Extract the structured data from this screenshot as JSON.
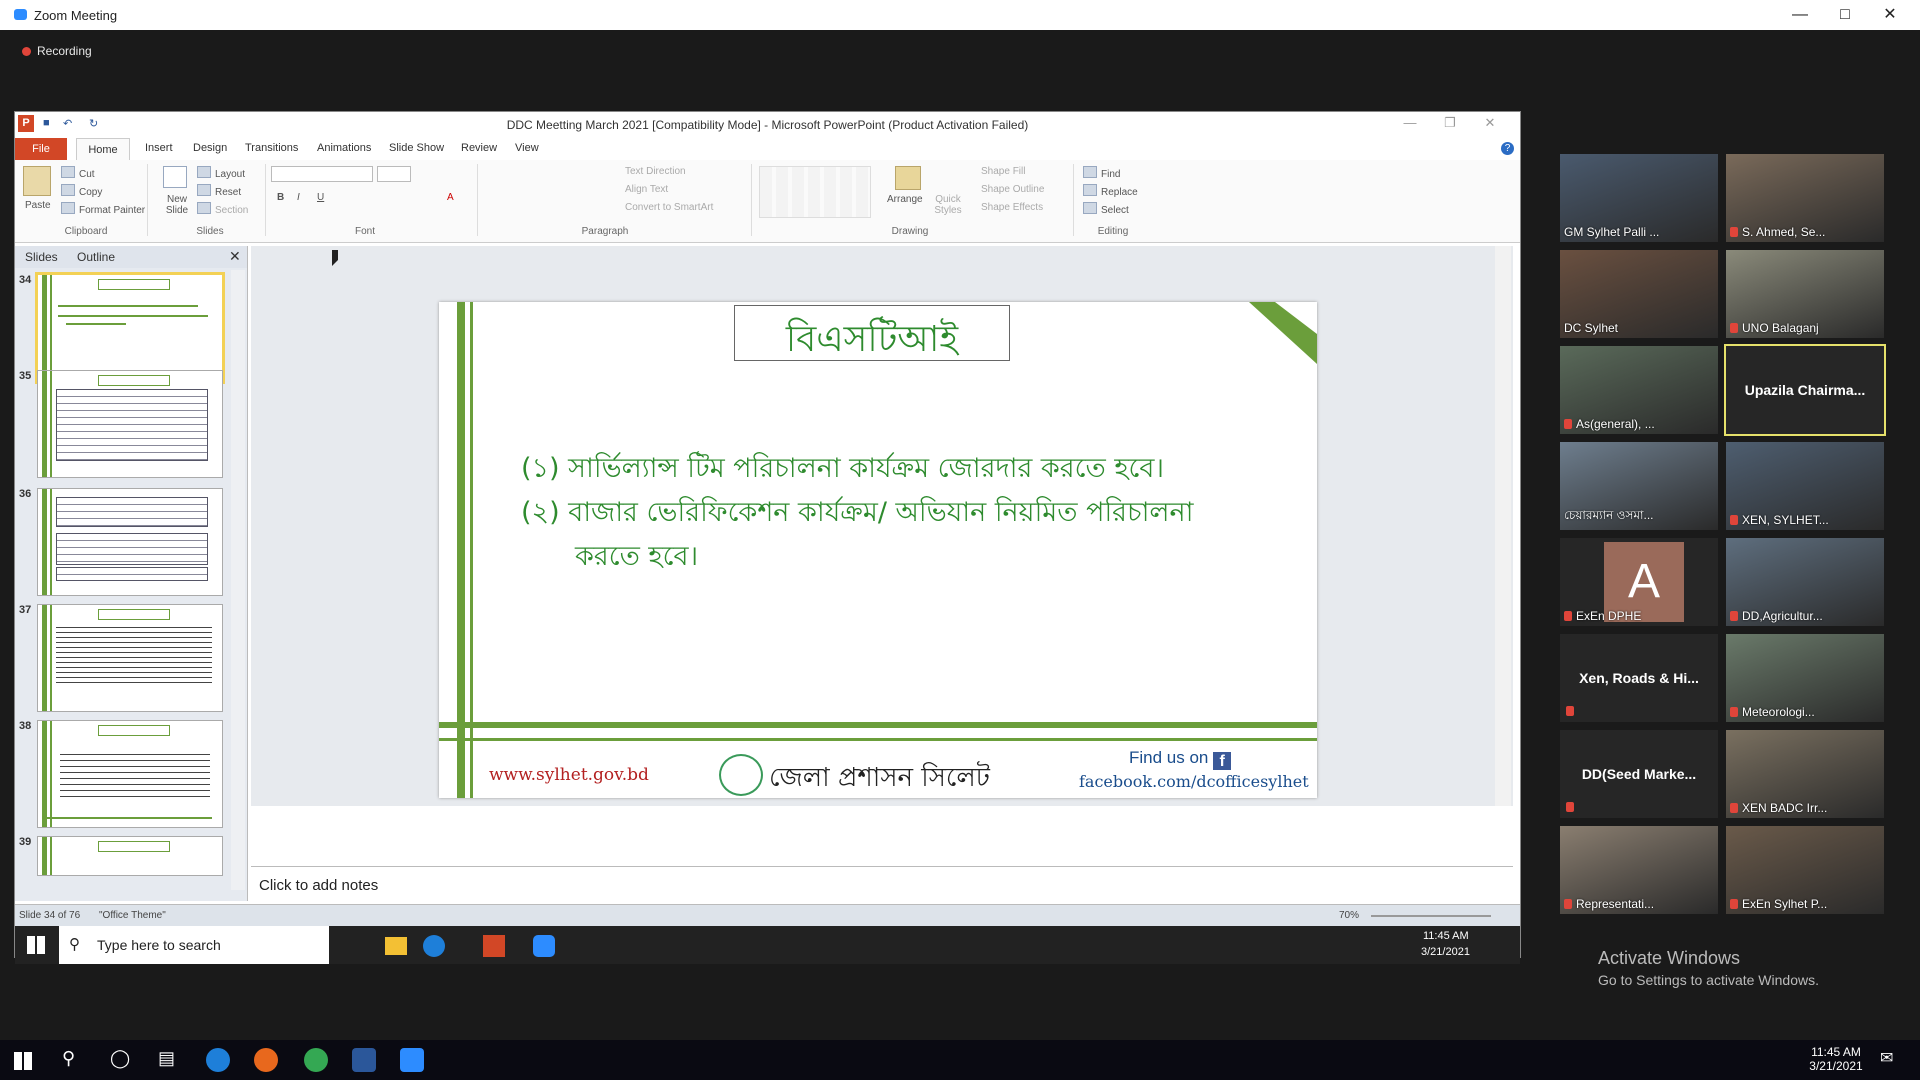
{
  "zoom": {
    "window_title": "Zoom Meeting",
    "recording": "Recording",
    "activate_title": "Activate Windows",
    "activate_sub": "Go to Settings to activate Windows."
  },
  "ppt": {
    "title": "DDC Meetting March 2021 [Compatibility Mode] - Microsoft PowerPoint (Product Activation Failed)",
    "tabs": [
      "File",
      "Home",
      "Insert",
      "Design",
      "Transitions",
      "Animations",
      "Slide Show",
      "Review",
      "View"
    ],
    "ribbon": {
      "paste": "Paste",
      "cut": "Cut",
      "copy": "Copy",
      "format_painter": "Format Painter",
      "clipboard": "Clipboard",
      "new_slide": "New Slide",
      "layout": "Layout",
      "reset": "Reset",
      "section": "Section",
      "slides": "Slides",
      "font": "Font",
      "text_direction": "Text Direction",
      "align_text": "Align Text",
      "convert_smartart": "Convert to SmartArt",
      "paragraph": "Paragraph",
      "arrange": "Arrange",
      "quick_styles": "Quick Styles",
      "shape_fill": "Shape Fill",
      "shape_outline": "Shape Outline",
      "shape_effects": "Shape Effects",
      "drawing": "Drawing",
      "find": "Find",
      "replace": "Replace",
      "select": "Select",
      "editing": "Editing"
    },
    "pane_tabs": {
      "slides": "Slides",
      "outline": "Outline"
    },
    "thumb_numbers": [
      "34",
      "35",
      "36",
      "37",
      "38",
      "39"
    ],
    "slide": {
      "title": "বিএসটিআই",
      "bullet1": "(১) সার্ভিল্যান্স টিম পরিচালনা কার্যক্রম জোরদার করতে হবে।",
      "bullet2a": "(২) বাজার ভেরিফিকেশন কার্যক্রম/ অভিযান নিয়মিত পরিচালনা",
      "bullet2b": "করতে হবে।",
      "url": "www.sylhet.gov.bd",
      "org": "জেলা প্রশাসন সিলেট",
      "find_us": "Find us on",
      "fb_letter": "f",
      "fb": "facebook.com/dcofficesylhet"
    },
    "notes": "Click to add notes",
    "status": {
      "slide": "Slide 34 of 76",
      "theme": "\"Office Theme\"",
      "zoom": "70%"
    },
    "inner_taskbar": {
      "search": "Type here to search",
      "time": "11:45 AM",
      "date": "3/21/2021"
    }
  },
  "participants": [
    {
      "name": "GM Sylhet Palli ...",
      "type": "video",
      "muted": false
    },
    {
      "name": "S. Ahmed, Se...",
      "type": "video",
      "muted": true
    },
    {
      "name": "DC Sylhet",
      "type": "video",
      "muted": false
    },
    {
      "name": "UNO Balaganj",
      "type": "video",
      "muted": true
    },
    {
      "name": "As(general), ...",
      "type": "video",
      "muted": true
    },
    {
      "name": "Upazila  Chairma...",
      "type": "name",
      "muted": false,
      "active": true
    },
    {
      "name": "চেয়ারম্যান ওসমা...",
      "type": "video",
      "muted": false
    },
    {
      "name": "XEN, SYLHET...",
      "type": "video",
      "muted": true
    },
    {
      "name": "ExEn DPHE",
      "type": "avatar",
      "letter": "A",
      "muted": true
    },
    {
      "name": "DD,Agricultur...",
      "type": "video",
      "muted": true
    },
    {
      "name": "Xen, Roads & Hi...",
      "type": "name",
      "muted": true
    },
    {
      "name": "Meteorologi...",
      "type": "video",
      "muted": true
    },
    {
      "name": "DD(Seed  Marke...",
      "type": "name",
      "muted": true
    },
    {
      "name": "XEN BADC Irr...",
      "type": "video",
      "muted": true
    },
    {
      "name": "Representati...",
      "type": "video",
      "muted": true
    },
    {
      "name": "ExEn Sylhet P...",
      "type": "video",
      "muted": true
    }
  ],
  "taskbar": {
    "time": "11:45 AM",
    "date": "3/21/2021"
  },
  "colors": {
    "slide_green": "#6b9e3b",
    "title_green": "#2e8b2e",
    "ppt_red": "#d24726",
    "zoom_blue": "#2d8cff"
  }
}
